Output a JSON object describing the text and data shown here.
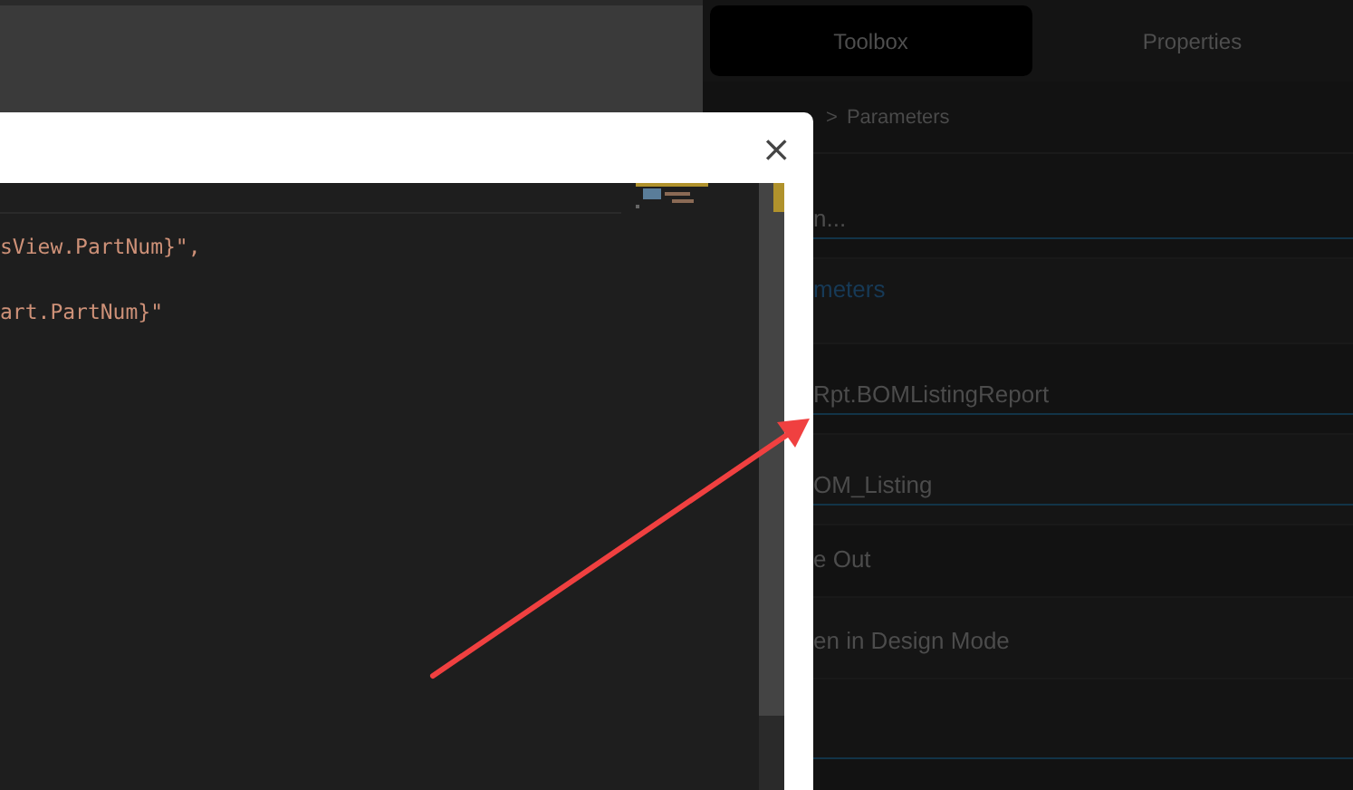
{
  "tabs": [
    {
      "label": "Toolbox",
      "selected": true
    },
    {
      "label": "Properties",
      "selected": false
    }
  ],
  "breadcrumb": {
    "separator": ">",
    "current": "Parameters"
  },
  "properties": [
    {
      "kind": "field",
      "text": "n..."
    },
    {
      "kind": "link",
      "text": "meters"
    },
    {
      "kind": "field",
      "text": "Rpt.BOMListingReport"
    },
    {
      "kind": "field",
      "text": "OM_Listing"
    },
    {
      "kind": "option",
      "text": "e Out"
    },
    {
      "kind": "option",
      "text": "en in Design Mode"
    }
  ],
  "dialog": {
    "close": "×",
    "code_lines": [
      "sView.PartNum}\",",
      "art.PartNum}\""
    ]
  },
  "annotation": {
    "kind": "arrow"
  }
}
